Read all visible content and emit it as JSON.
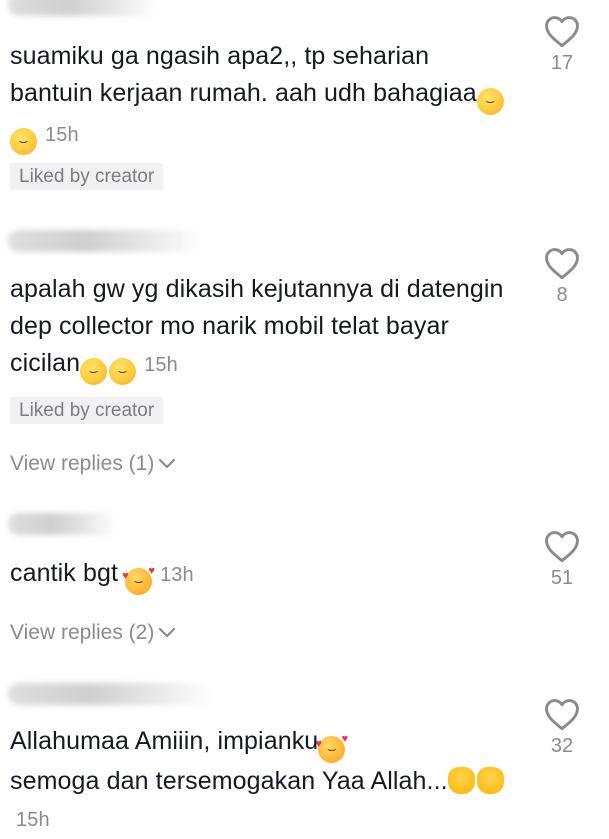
{
  "comments": [
    {
      "text": "suamiku ga ngasih apa2,, tp seharian bantuin kerjaan rumah. aah udh bahagiaa",
      "emojis": [
        "grinning-sweat-emoji",
        "grinning-sweat-emoji"
      ],
      "time": "15h",
      "liked_by_creator": "Liked by creator",
      "likes": "17"
    },
    {
      "text": "apalah gw yg dikasih kejutannya di datengin dep collector mo narik mobil telat bayar cicilan",
      "emojis": [
        "relieved-face-emoji",
        "relieved-face-emoji"
      ],
      "time": "15h",
      "liked_by_creator": "Liked by creator",
      "view_replies": "View replies (1)",
      "likes": "8"
    },
    {
      "text": "cantik bgt",
      "emojis": [
        "smiling-face-hearts-emoji"
      ],
      "time": "13h",
      "view_replies": "View replies (2)",
      "likes": "51"
    },
    {
      "text_line1": "Allahumaa Amiiin, impianku",
      "text_rest": "semoga dan tersemogakan Yaa Allah...",
      "emojis": [
        "smiling-face-hearts-emoji",
        "raised-hands-emoji",
        "raised-hands-emoji"
      ],
      "time": "15h",
      "likes": "32"
    }
  ]
}
